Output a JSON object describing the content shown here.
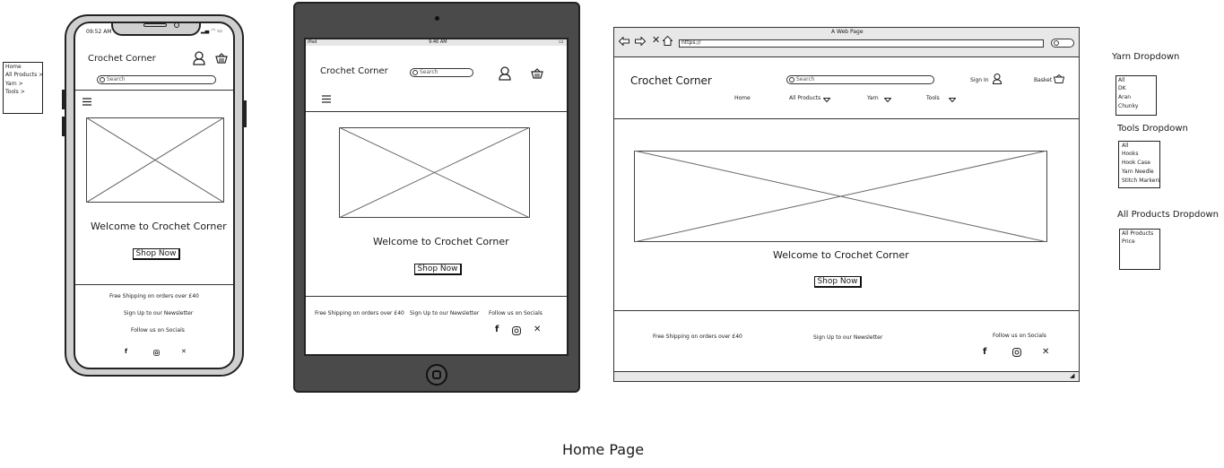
{
  "page_title": "Home Page",
  "mobile_menu": [
    "Home",
    "All Products >",
    "Yarn >",
    "Tools >"
  ],
  "phone": {
    "time": "09:52 AM",
    "brand": "Crochet Corner",
    "search_placeholder": "Search",
    "welcome": "Welcome to Crochet Corner",
    "shop_now": "Shop Now",
    "footer_shipping": "Free Shipping on orders over £40",
    "footer_newsletter": "Sign Up to our Newsletter",
    "footer_social": "Follow us on Socials"
  },
  "tablet": {
    "status_left": "iPad",
    "time": "9:46 AM",
    "brand": "Crochet Corner",
    "search_placeholder": "Search",
    "welcome": "Welcome to Crochet Corner",
    "shop_now": "Shop Now",
    "footer_shipping": "Free Shipping on orders over £40",
    "footer_newsletter": "Sign Up to our Newsletter",
    "footer_social": "Follow us on Socials"
  },
  "desktop": {
    "window_title": "A Web Page",
    "url": "https://",
    "brand": "Crochet Corner",
    "search_placeholder": "Search",
    "sign_in": "Sign In",
    "basket": "Basket",
    "nav": [
      "Home",
      "All Products",
      "Yarn",
      "Tools"
    ],
    "welcome": "Welcome to Crochet Corner",
    "shop_now": "Shop Now",
    "footer_shipping": "Free Shipping on orders over £40",
    "footer_newsletter": "Sign Up to our Newsletter",
    "footer_social": "Follow us on Socials"
  },
  "dropdowns": {
    "yarn": {
      "title": "Yarn Dropdown",
      "items": [
        "All",
        "DK",
        "Aran",
        "Chunky"
      ]
    },
    "tools": {
      "title": "Tools Dropdown",
      "items": [
        "All",
        "Hooks",
        "Hook Case",
        "Yarn Needle",
        "Stitch Markers"
      ]
    },
    "all_products": {
      "title": "All Products Dropdown",
      "items": [
        "All Products",
        "Price"
      ]
    }
  }
}
